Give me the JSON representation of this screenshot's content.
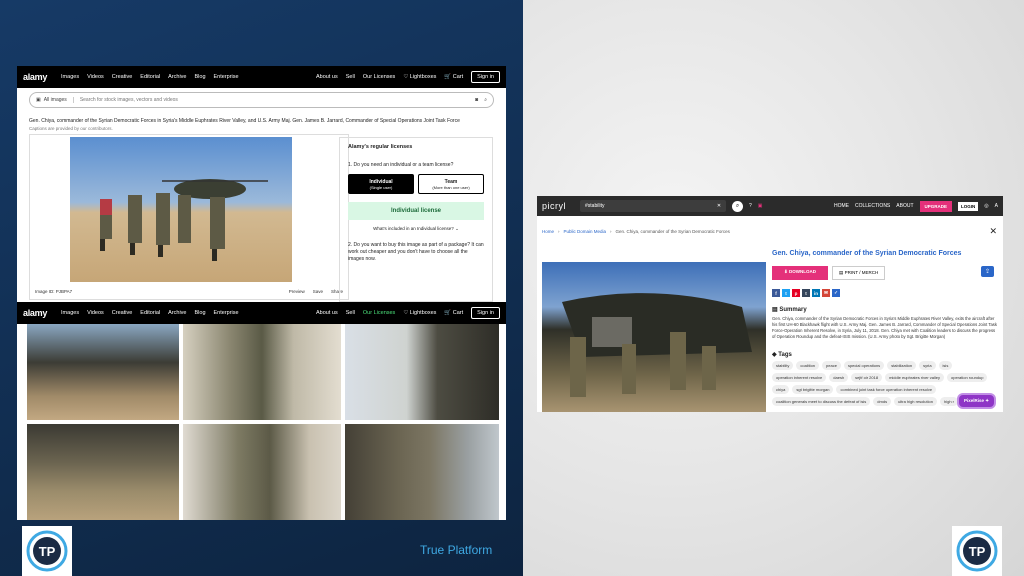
{
  "alamy_top": {
    "logo": "alamy",
    "nav": [
      "Images",
      "Videos",
      "Creative",
      "Editorial",
      "Archive",
      "Blog",
      "Enterprise"
    ],
    "right_nav": [
      "About us",
      "Sell",
      "Our Licenses",
      "Lightboxes",
      "Cart"
    ],
    "sign_in": "Sign in",
    "search_all": "All images",
    "search_placeholder": "Search for stock images, vectors and videos",
    "caption": "Gen. Chiya, commander of the Syrian Democratic Forces in Syria's Middle Euphrates River Valley, and U.S. Army Maj. Gen. James B. Jarrard, Commander of Special Operations Joint Task Force",
    "caption_sub": "Captions are provided by our contributors.",
    "image_id": "Image ID: PJBPA7",
    "img_actions": [
      "Preview",
      "Save",
      "Share"
    ]
  },
  "license": {
    "title": "Alamy's regular licenses",
    "q1": "1.  Do you need an individual or a team license?",
    "individual": "Individual",
    "individual_sub": "(Single user)",
    "team": "Team",
    "team_sub": "(More than one user)",
    "cta": "Individual license",
    "included": "What's included in an Individual license?",
    "q2": "2.  Do you want to buy this image as part of a package? It can work out cheaper and you don't have to choose all the images now."
  },
  "alamy_bottom": {
    "logo": "alamy",
    "nav": [
      "Images",
      "Videos",
      "Creative",
      "Editorial",
      "Archive",
      "Blog",
      "Enterprise"
    ],
    "right_nav": [
      "About us",
      "Sell",
      "Our Licenses",
      "Lightboxes",
      "Cart"
    ],
    "sign_in": "Sign in"
  },
  "picryl": {
    "logo": "picryl",
    "search_value": "#stability",
    "nav": [
      "HOME",
      "COLLECTIONS",
      "ABOUT"
    ],
    "upgrade": "UPGRADE",
    "login": "LOGIN",
    "breadcrumb": [
      "Home",
      "Public Domain Media",
      "Gen. Chiya, commander of the Syrian Democratic Forces"
    ],
    "title": "Gen. Chiya, commander of the Syrian Democratic Forces",
    "download": "DOWNLOAD",
    "print_merch": "PRINT / MERCH",
    "social": [
      "f",
      "t",
      "p",
      "t",
      "in",
      "✉",
      "✓"
    ],
    "summary_h": "Summary",
    "summary": "Gen. Chiya, commander of the Syrian Democratic Forces in Syria's Middle Euphrates River Valley, exits the aircraft after his first UH-60 Blackhawk flight with U.S. Army Maj. Gen. James B. Jarrard, Commander of Special Operations Joint Task Force-Operation Inherent Resolve, in Syria, July 11, 2018. Gen. Chiya met with Coalition leaders to discuss the progress of Operation Roundup and the defeat-ISIS mission. (U.S. Army photo by Sgt. Brigitte Morgan)",
    "tags_h": "Tags",
    "tags": [
      "stability",
      "coalition",
      "peace",
      "special operations",
      "stabilization",
      "syria",
      "isis",
      "operation inherent resolve",
      "daesh",
      "sejtf oir 2018",
      "middle euphrates river valley",
      "operation roundup",
      "chiya",
      "sgt brigitte morgan",
      "combined joint task force operation inherent resolve",
      "coalition generals meet to discuss the defeat of isis",
      "dmds",
      "ultra high resolution",
      "high r"
    ],
    "pixel": "PixelRise"
  },
  "brand": {
    "text": "True Platform",
    "logo_text": "TP"
  }
}
